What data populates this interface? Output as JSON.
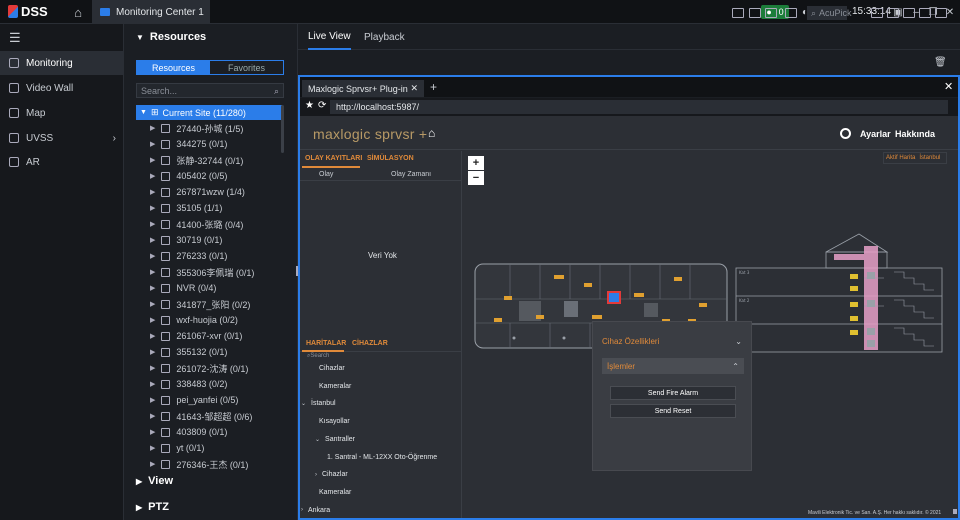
{
  "app": {
    "logo": "DSS",
    "tab_title": "Monitoring Center 1",
    "alarm_count": "0",
    "clock": "15:33:14"
  },
  "nav": {
    "items": [
      {
        "label": "Monitoring",
        "icon": "monitor-icon",
        "active": true
      },
      {
        "label": "Video Wall",
        "icon": "video-wall-icon"
      },
      {
        "label": "Map",
        "icon": "map-icon"
      },
      {
        "label": "UVSS",
        "icon": "uvss-icon"
      },
      {
        "label": "AR",
        "icon": "ar-icon"
      }
    ]
  },
  "resources": {
    "title": "Resources",
    "tabs": [
      "Resources",
      "Favorites"
    ],
    "search_placeholder": "Search...",
    "current_site": "Current Site (11/280)",
    "nodes": [
      "27440-孙城 (1/5)",
      "344275 (0/1)",
      "张静-32744 (0/1)",
      "405402 (0/5)",
      "267871wzw (1/4)",
      "35105 (1/1)",
      "41400-张璐 (0/4)",
      "30719 (0/1)",
      "276233 (0/1)",
      "355306李佩瑞 (0/1)",
      "NVR (0/4)",
      "341877_张阳 (0/2)",
      "wxf-huojia (0/2)",
      "261067-xvr (0/1)",
      "355132 (0/1)",
      "261072-沈涛 (0/1)",
      "338483 (0/2)",
      "pei_yanfei (0/5)",
      "41643-邹超超 (0/6)",
      "403809 (0/1)",
      "yt (0/1)",
      "276346-王杰 (0/1)"
    ],
    "view_label": "View",
    "ptz_label": "PTZ"
  },
  "live": {
    "tabs": [
      "Live View",
      "Playback"
    ],
    "acupick": "AcuPick"
  },
  "browser": {
    "tab_title": "Maxlogic Sprvsr+ Plug-in",
    "url": "http://localhost:5987/"
  },
  "maxlogic": {
    "brand": "maxlogic sprvsr +",
    "ayarlar": "Ayarlar",
    "hakkinda": "Hakkında",
    "event_tabs": [
      "OLAY KAYITLARI",
      "SİMÜLASYON"
    ],
    "event_cols": [
      "Olay",
      "Olay Zamanı"
    ],
    "empty": "Veri Yok",
    "map_tabs": [
      "HARİTALAR",
      "CİHAZLAR"
    ],
    "search_placeholder": "Search",
    "tree": [
      {
        "label": "Cihazlar",
        "indent": 1,
        "caret": ""
      },
      {
        "label": "Kameralar",
        "indent": 1,
        "caret": ""
      },
      {
        "label": "İstanbul",
        "indent": 0,
        "caret": "v"
      },
      {
        "label": "Kısayollar",
        "indent": 1,
        "caret": ""
      },
      {
        "label": "Santraller",
        "indent": 1,
        "caret": "v"
      },
      {
        "label": "1. Santral - ML-12XX Oto-Öğrenme",
        "indent": 2,
        "caret": ""
      },
      {
        "label": "Cihazlar",
        "indent": 1,
        "caret": ">"
      },
      {
        "label": "Kameralar",
        "indent": 1,
        "caret": ""
      },
      {
        "label": "Ankara",
        "indent": 0,
        "caret": ">"
      }
    ],
    "map_links": [
      "Aktif Harita",
      "İstanbul"
    ],
    "popup": {
      "cihaz": "Cihaz Özellikleri",
      "islemler": "İşlemler",
      "fire": "Send Fire Alarm",
      "reset": "Send Reset"
    },
    "footer": "Mavili Elektronik Tic. ve San. A.Ş. Her hakkı saklıdır. © 2021"
  }
}
